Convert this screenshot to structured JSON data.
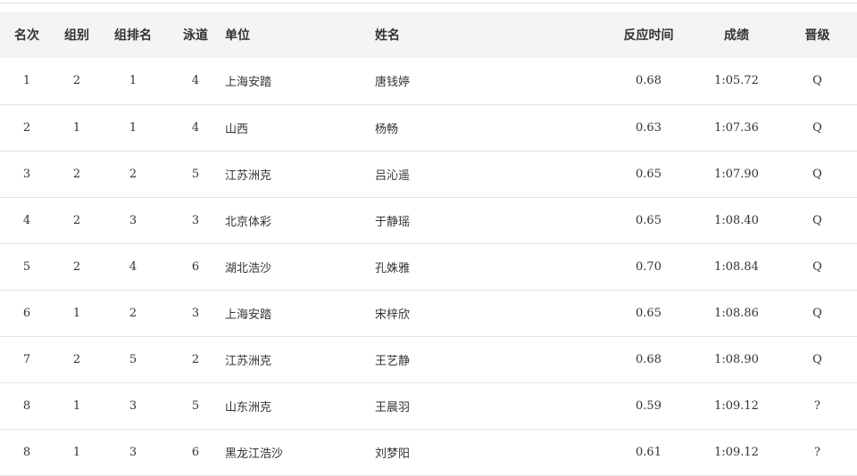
{
  "table": {
    "headers": {
      "rank": "名次",
      "group": "组别",
      "group_rank": "组排名",
      "lane": "泳道",
      "unit": "单位",
      "name": "姓名",
      "reaction": "反应时间",
      "result": "成绩",
      "qualify": "晋级"
    },
    "rows": [
      {
        "rank": "1",
        "group": "2",
        "group_rank": "1",
        "lane": "4",
        "unit": "上海安踏",
        "name": "唐钱婷",
        "reaction": "0.68",
        "result": "1:05.72",
        "qualify": "Q"
      },
      {
        "rank": "2",
        "group": "1",
        "group_rank": "1",
        "lane": "4",
        "unit": "山西",
        "name": "杨畅",
        "reaction": "0.63",
        "result": "1:07.36",
        "qualify": "Q"
      },
      {
        "rank": "3",
        "group": "2",
        "group_rank": "2",
        "lane": "5",
        "unit": "江苏洲克",
        "name": "吕沁遥",
        "reaction": "0.65",
        "result": "1:07.90",
        "qualify": "Q"
      },
      {
        "rank": "4",
        "group": "2",
        "group_rank": "3",
        "lane": "3",
        "unit": "北京体彩",
        "name": "于静瑶",
        "reaction": "0.65",
        "result": "1:08.40",
        "qualify": "Q"
      },
      {
        "rank": "5",
        "group": "2",
        "group_rank": "4",
        "lane": "6",
        "unit": "湖北浩沙",
        "name": "孔姝雅",
        "reaction": "0.70",
        "result": "1:08.84",
        "qualify": "Q"
      },
      {
        "rank": "6",
        "group": "1",
        "group_rank": "2",
        "lane": "3",
        "unit": "上海安踏",
        "name": "宋梓欣",
        "reaction": "0.65",
        "result": "1:08.86",
        "qualify": "Q"
      },
      {
        "rank": "7",
        "group": "2",
        "group_rank": "5",
        "lane": "2",
        "unit": "江苏洲克",
        "name": "王艺静",
        "reaction": "0.68",
        "result": "1:08.90",
        "qualify": "Q"
      },
      {
        "rank": "8",
        "group": "1",
        "group_rank": "3",
        "lane": "5",
        "unit": "山东洲克",
        "name": "王晨羽",
        "reaction": "0.59",
        "result": "1:09.12",
        "qualify": "?"
      },
      {
        "rank": "8",
        "group": "1",
        "group_rank": "3",
        "lane": "6",
        "unit": "黑龙江浩沙",
        "name": "刘梦阳",
        "reaction": "0.61",
        "result": "1:09.12",
        "qualify": "?"
      }
    ]
  }
}
